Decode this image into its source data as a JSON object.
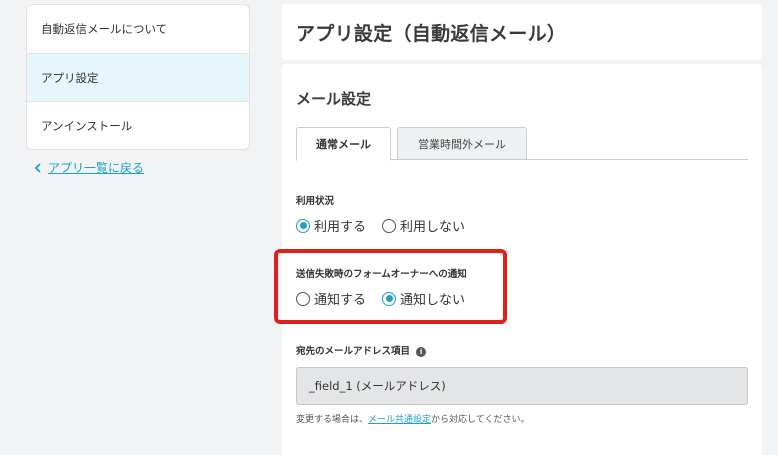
{
  "sidebar": {
    "items": [
      {
        "label": "自動返信メールについて"
      },
      {
        "label": "アプリ設定"
      },
      {
        "label": "アンインストール"
      }
    ],
    "back_link": "アプリ一覧に戻る"
  },
  "header": {
    "title": "アプリ設定（自動返信メール）"
  },
  "main": {
    "section_title": "メール設定",
    "tabs": [
      {
        "label": "通常メール"
      },
      {
        "label": "営業時間外メール"
      }
    ],
    "usage": {
      "label": "利用状況",
      "options": [
        "利用する",
        "利用しない"
      ],
      "selected": "利用する"
    },
    "notify": {
      "label": "送信失敗時のフォームオーナーへの通知",
      "options": [
        "通知する",
        "通知しない"
      ],
      "selected": "通知しない"
    },
    "address_field": {
      "label": "宛先のメールアドレス項目",
      "info_icon": "i",
      "value": "_field_1 (メールアドレス)"
    },
    "help": {
      "prefix": "変更する場合は、",
      "link": "メール共通設定",
      "suffix": "から対応してください。"
    }
  },
  "colors": {
    "accent": "#1fa0c8",
    "highlight": "#e0201b",
    "active_item_bg": "#e6f6fa"
  }
}
